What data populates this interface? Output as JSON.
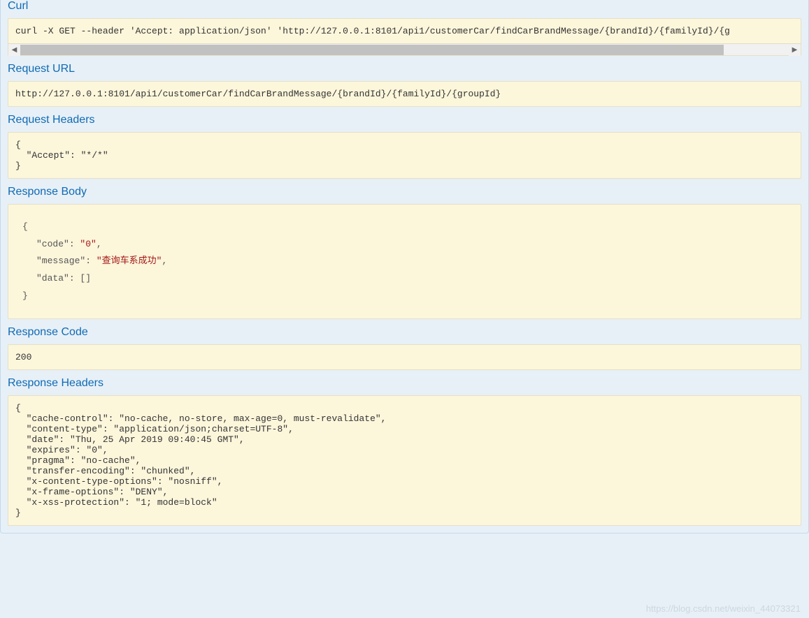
{
  "sections": {
    "curl": {
      "title": "Curl",
      "content": "curl -X GET --header 'Accept: application/json' 'http://127.0.0.1:8101/api1/customerCar/findCarBrandMessage/{brandId}/{familyId}/{g"
    },
    "request_url": {
      "title": "Request URL",
      "content": "http://127.0.0.1:8101/api1/customerCar/findCarBrandMessage/{brandId}/{familyId}/{groupId}"
    },
    "request_headers": {
      "title": "Request Headers",
      "content": "{\n  \"Accept\": \"*/*\"\n}"
    },
    "response_body": {
      "title": "Response Body",
      "json": {
        "code_key": "\"code\"",
        "code_val": "\"0\"",
        "message_key": "\"message\"",
        "message_val": "\"查询车系成功\"",
        "data_key": "\"data\"",
        "data_val": "[]"
      }
    },
    "response_code": {
      "title": "Response Code",
      "content": "200"
    },
    "response_headers": {
      "title": "Response Headers",
      "content": "{\n  \"cache-control\": \"no-cache, no-store, max-age=0, must-revalidate\",\n  \"content-type\": \"application/json;charset=UTF-8\",\n  \"date\": \"Thu, 25 Apr 2019 09:40:45 GMT\",\n  \"expires\": \"0\",\n  \"pragma\": \"no-cache\",\n  \"transfer-encoding\": \"chunked\",\n  \"x-content-type-options\": \"nosniff\",\n  \"x-frame-options\": \"DENY\",\n  \"x-xss-protection\": \"1; mode=block\"\n}"
    }
  },
  "watermark": "https://blog.csdn.net/weixin_44073321"
}
